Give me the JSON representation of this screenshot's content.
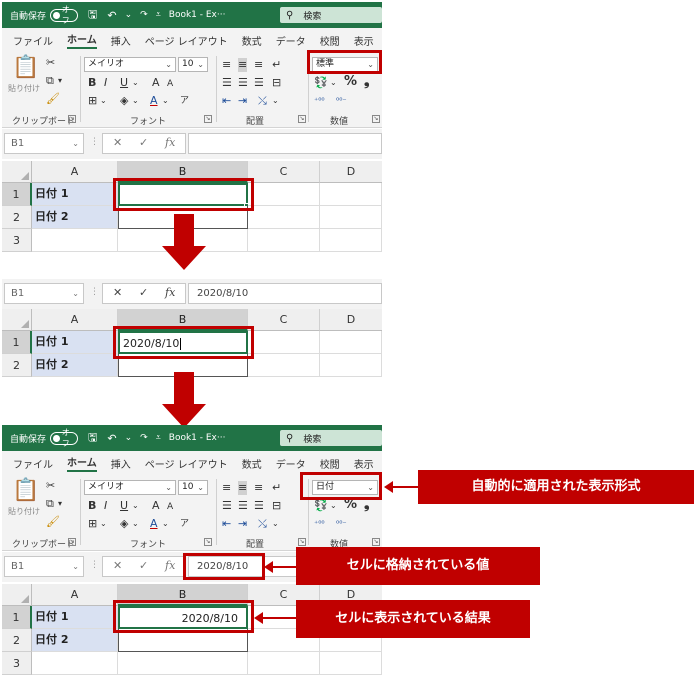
{
  "titlebar": {
    "autosave": "自動保存",
    "toggle": "オフ",
    "book": "Book1 - Ex···",
    "search": "検索"
  },
  "tabs": [
    "ファイル",
    "ホーム",
    "挿入",
    "ページ レイアウト",
    "数式",
    "データ",
    "校閲",
    "表示"
  ],
  "ribbon": {
    "paste_label": "貼り付け",
    "clipboard_label": "クリップボード",
    "font_name": "メイリオ",
    "font_size": "10",
    "font_group_label": "フォント",
    "align_group_label": "配置",
    "number_group_label": "数値",
    "bold": "B",
    "italic": "I",
    "underline": "U",
    "font_color_letter": "A",
    "grow_font": "A",
    "shrink_font": "A",
    "percent": "%",
    "comma": "❟"
  },
  "formats": {
    "before": "標準",
    "after": "日付"
  },
  "name_box": "B1",
  "fx": "fx",
  "formula_value": "2020/8/10",
  "columns": [
    "A",
    "B",
    "C",
    "D"
  ],
  "rows": [
    "1",
    "2",
    "3"
  ],
  "cells": {
    "a1": "日付 1",
    "a2": "日付 2",
    "b1_typed": "2020/8/10",
    "b1_result": "2020/8/10"
  },
  "callouts": {
    "format": "自動的に適用された表示形式",
    "stored": "セルに格納されている値",
    "displayed": "セルに表示されている結果"
  },
  "colors": {
    "excel_green": "#217346",
    "highlight_red": "#c00000",
    "header_fill": "#d9e1f2"
  }
}
